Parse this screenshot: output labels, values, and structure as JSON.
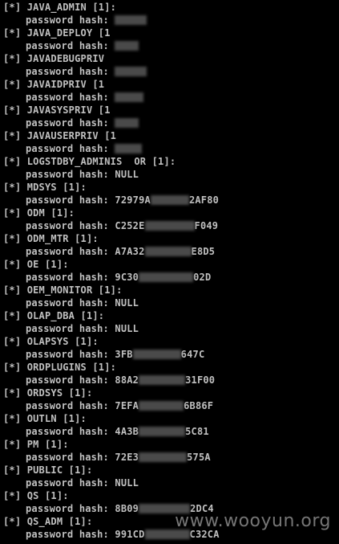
{
  "colors": {
    "background": "#000000",
    "text": "#c0c0c0",
    "mask": "#4a4a4a",
    "watermark": "#8a8a8a"
  },
  "hash_label": "password hash:",
  "entries": [
    {
      "account": "[*] JAVA_ADMIN [1]:",
      "hash_prefix": "",
      "hash_suffix": ""
    },
    {
      "account": "[*] JAVA_DEPLOY [1",
      "hash_prefix": "",
      "hash_suffix": ""
    },
    {
      "account": "[*] JAVADEBUGPRIV",
      "hash_prefix": "",
      "hash_suffix": ""
    },
    {
      "account": "[*] JAVAIDPRIV [1",
      "hash_prefix": "",
      "hash_suffix": ""
    },
    {
      "account": "[*] JAVASYSPRIV [1",
      "hash_prefix": "",
      "hash_suffix": ""
    },
    {
      "account": "[*] JAVAUSERPRIV [1",
      "hash_prefix": "",
      "hash_suffix": ""
    },
    {
      "account": "[*] LOGSTDBY_ADMINIS  OR [1]:",
      "hash_prefix": "NULL",
      "hash_suffix": ""
    },
    {
      "account": "[*] MDSYS [1]:",
      "hash_prefix": "72979A",
      "hash_suffix": "2AF80"
    },
    {
      "account": "[*] ODM [1]:",
      "hash_prefix": "C252E",
      "hash_suffix": "F049"
    },
    {
      "account": "[*] ODM_MTR [1]:",
      "hash_prefix": "A7A32",
      "hash_suffix": "E8D5"
    },
    {
      "account": "[*] OE [1]:",
      "hash_prefix": "9C30",
      "hash_suffix": "02D"
    },
    {
      "account": "[*] OEM_MONITOR [1]:",
      "hash_prefix": "NULL",
      "hash_suffix": ""
    },
    {
      "account": "[*] OLAP_DBA [1]:",
      "hash_prefix": "NULL",
      "hash_suffix": ""
    },
    {
      "account": "[*] OLAPSYS [1]:",
      "hash_prefix": "3FB",
      "hash_suffix": "647C"
    },
    {
      "account": "[*] ORDPLUGINS [1]:",
      "hash_prefix": "88A2",
      "hash_suffix": "31F00"
    },
    {
      "account": "[*] ORDSYS [1]:",
      "hash_prefix": "7EFA",
      "hash_suffix": "6B86F"
    },
    {
      "account": "[*] OUTLN [1]:",
      "hash_prefix": "4A3B",
      "hash_suffix": "5C81"
    },
    {
      "account": "[*] PM [1]:",
      "hash_prefix": "72E3",
      "hash_suffix": "575A"
    },
    {
      "account": "[*] PUBLIC [1]:",
      "hash_prefix": "NULL",
      "hash_suffix": ""
    },
    {
      "account": "[*] QS [1]:",
      "hash_prefix": "8B09",
      "hash_suffix": "2DC4"
    },
    {
      "account": "[*] QS_ADM [1]:",
      "hash_prefix": "991CD",
      "hash_suffix": "C32CA"
    }
  ],
  "watermark": "www.wooyun.org"
}
